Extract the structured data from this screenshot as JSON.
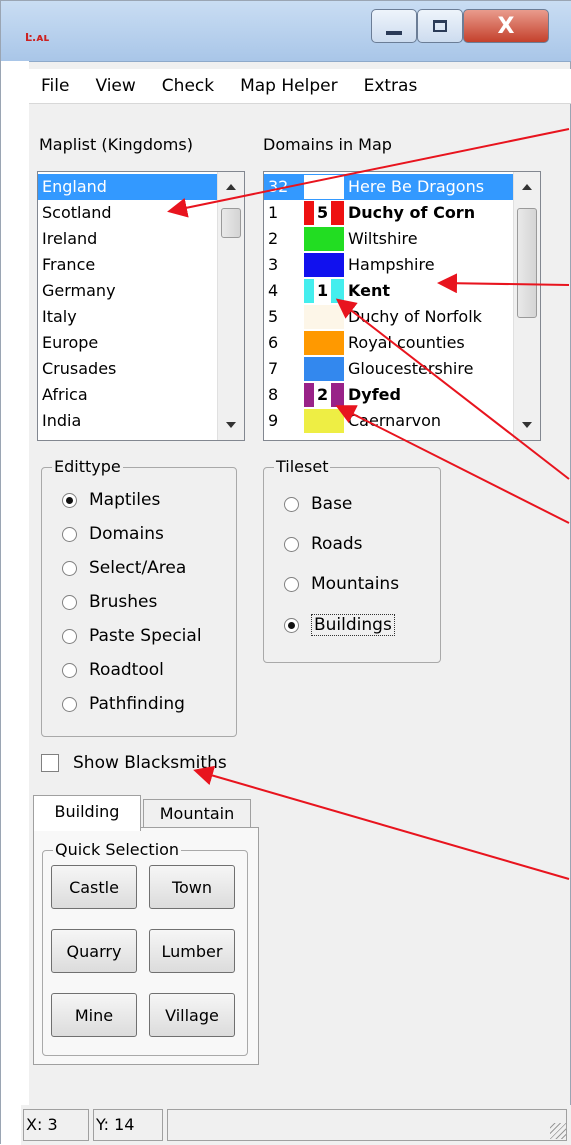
{
  "window": {
    "app_icon_text": "Ŀ.ᴀʟ",
    "minimize_glyph": "",
    "maximize_glyph": "",
    "close_glyph": "X"
  },
  "menu": [
    "File",
    "View",
    "Check",
    "Map Helper",
    "Extras"
  ],
  "maplist": {
    "label": "Maplist (Kingdoms)",
    "items": [
      "England",
      "Scotland",
      "Ireland",
      "France",
      "Germany",
      "Italy",
      "Europe",
      "Crusades",
      "Africa",
      "India",
      "..."
    ],
    "selected_index": 0
  },
  "domains": {
    "label": "Domains in Map",
    "rows": [
      {
        "num": "32",
        "name": "Here Be Dragons",
        "color": "#ffffff",
        "selected": true,
        "bold": false,
        "mark": ""
      },
      {
        "num": "1",
        "name": "Duchy of Corn",
        "color": "#ee1111",
        "selected": false,
        "bold": true,
        "mark": "5"
      },
      {
        "num": "2",
        "name": "Wiltshire",
        "color": "#22dd22",
        "selected": false,
        "bold": false,
        "mark": ""
      },
      {
        "num": "3",
        "name": "Hampshire",
        "color": "#1111ee",
        "selected": false,
        "bold": false,
        "mark": ""
      },
      {
        "num": "4",
        "name": "Kent",
        "color": "#44eeee",
        "selected": false,
        "bold": true,
        "mark": "1"
      },
      {
        "num": "5",
        "name": "Duchy of Norfolk",
        "color": "#fdf6e8",
        "selected": false,
        "bold": false,
        "mark": ""
      },
      {
        "num": "6",
        "name": "Royal counties",
        "color": "#ff9900",
        "selected": false,
        "bold": false,
        "mark": ""
      },
      {
        "num": "7",
        "name": "Gloucestershire",
        "color": "#3388ee",
        "selected": false,
        "bold": false,
        "mark": ""
      },
      {
        "num": "8",
        "name": "Dyfed",
        "color": "#992288",
        "selected": false,
        "bold": true,
        "mark": "2"
      },
      {
        "num": "9",
        "name": "Caernarvon",
        "color": "#eeee44",
        "selected": false,
        "bold": false,
        "mark": ""
      }
    ]
  },
  "edittype": {
    "title": "Edittype",
    "options": [
      "Maptiles",
      "Domains",
      "Select/Area",
      "Brushes",
      "Paste Special",
      "Roadtool",
      "Pathfinding"
    ],
    "selected_index": 0
  },
  "tileset": {
    "title": "Tileset",
    "options": [
      "Base",
      "Roads",
      "Mountains",
      "Buildings"
    ],
    "selected_index": 3
  },
  "show_blacksmiths": {
    "label": "Show Blacksmiths",
    "checked": false
  },
  "tabs": [
    "Building",
    "Mountain"
  ],
  "quick_selection": {
    "title": "Quick Selection",
    "buttons": [
      "Castle",
      "Town",
      "Quarry",
      "Lumber",
      "Mine",
      "Village"
    ]
  },
  "status": {
    "x": "X: 3",
    "y": "Y: 14"
  },
  "colors": {
    "annotation_arrow": "#e8141e",
    "selection": "#3399ff"
  }
}
